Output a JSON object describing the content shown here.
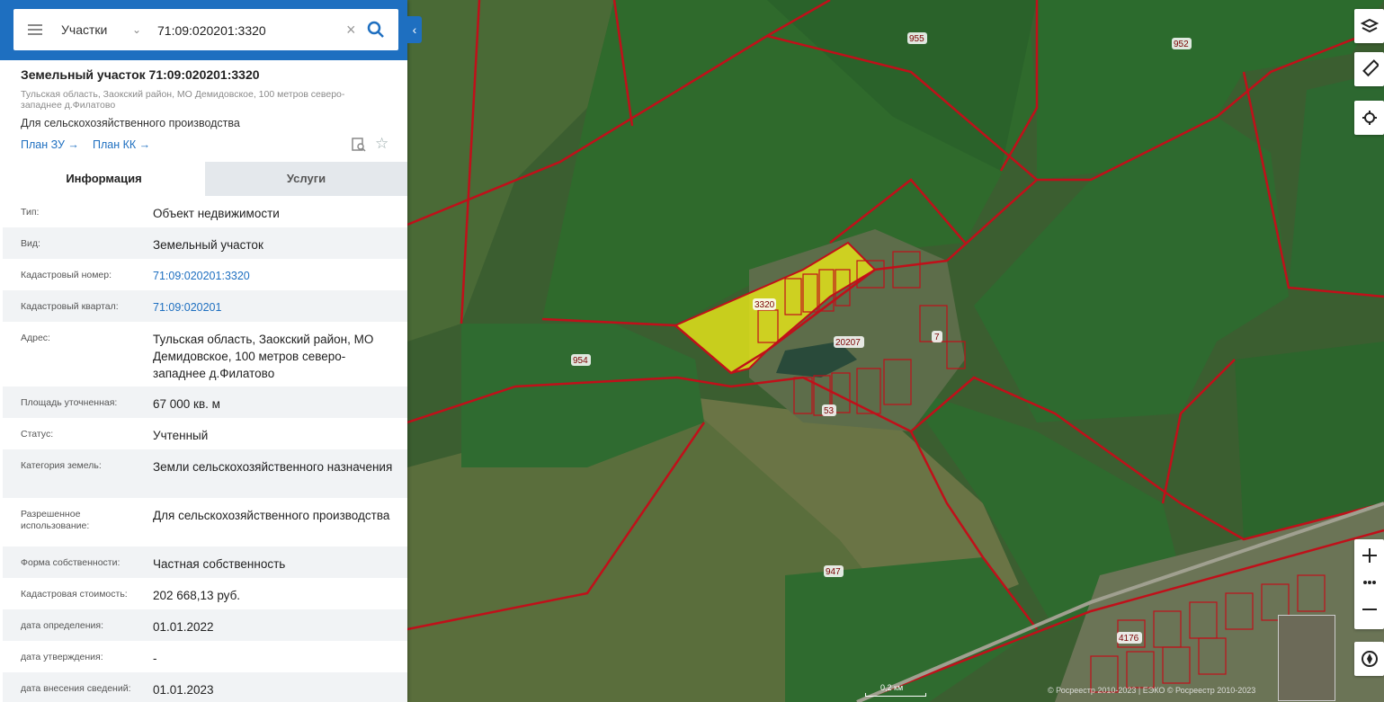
{
  "search": {
    "layer": "Участки",
    "query": "71:09:020201:3320"
  },
  "object": {
    "title": "Земельный участок 71:09:020201:3320",
    "address": "Тульская область, Заокский район, МО Демидовское, 100 метров северо-западнее д.Филатово",
    "use": "Для сельскохозяйственного производства",
    "plan_zu": "План ЗУ →",
    "plan_kk": "План КК →"
  },
  "tabs": {
    "info": "Информация",
    "services": "Услуги"
  },
  "rows": [
    {
      "label": "Тип:",
      "value": "Объект недвижимости"
    },
    {
      "label": "Вид:",
      "value": "Земельный участок"
    },
    {
      "label": "Кадастровый номер:",
      "value": "71:09:020201:3320"
    },
    {
      "label": "Кадастровый квартал:",
      "value": "71:09:020201"
    },
    {
      "label": "Адрес:",
      "value": "Тульская область, Заокский район, МО Демидовское, 100 метров северо-западнее д.Филатово"
    },
    {
      "label": "Площадь уточненная:",
      "value": "67 000 кв. м"
    },
    {
      "label": "Статус:",
      "value": "Учтенный"
    },
    {
      "label": "Категория земель:",
      "value": "Земли сельскохозяйственного назначения"
    },
    {
      "label": "Разрешенное использование:",
      "value": "Для сельскохозяйственного производства"
    },
    {
      "label": "Форма собственности:",
      "value": "Частная собственность"
    },
    {
      "label": "Кадастровая стоимость:",
      "value": "202 668,13 руб."
    },
    {
      "label": "дата определения:",
      "value": "01.01.2022"
    },
    {
      "label": "дата утверждения:",
      "value": "-"
    },
    {
      "label": "дата внесения сведений:",
      "value": "01.01.2023"
    }
  ],
  "map": {
    "labels": {
      "l955": "955",
      "l952": "952",
      "l3320": "3320",
      "l20207": "20207",
      "l954": "954",
      "l947": "947",
      "l4176": "4176",
      "l7": "7",
      "l53": "53"
    },
    "scale": "0,2 км",
    "attribution": "© Росреестр 2010-2023 | ЕЭКО © Росреестр 2010-2023",
    "colors": {
      "boundary": "#c0101a",
      "selected": "#e2e21a",
      "field": "#2e5f2a"
    }
  },
  "icons": {
    "layers": "layers-icon",
    "ruler": "ruler-icon",
    "locate": "crosshair-icon",
    "zoom_in": "plus-icon",
    "more": "more-icon",
    "zoom_out": "minus-icon",
    "compass": "compass-icon"
  }
}
